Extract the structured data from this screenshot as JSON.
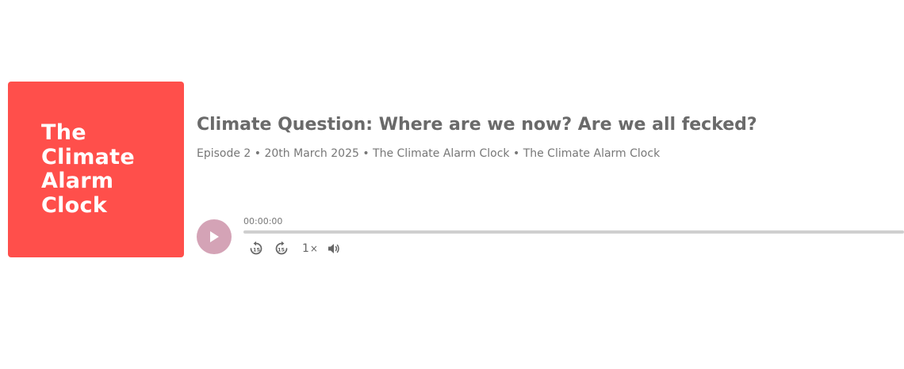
{
  "cover": {
    "lines": [
      "The",
      "Climate",
      "Alarm",
      "Clock"
    ],
    "background": "#ff4f4b"
  },
  "episode": {
    "title": "Climate Question: Where are we now? Are we all fecked?",
    "meta": "Episode 2 • 20th March 2025 • The Climate Alarm Clock • The Climate Alarm Clock"
  },
  "player": {
    "current_time": "00:00:00",
    "progress": 0,
    "speed_value": "1",
    "speed_symbol": "×",
    "rewind_seconds": "15",
    "forward_seconds": "15"
  },
  "icons": {
    "play": "play-icon",
    "rewind": "rewind-15-icon",
    "forward": "forward-15-icon",
    "volume": "volume-icon"
  },
  "colors": {
    "cover": "#ff4f4b",
    "play_button": "#d4a3b6",
    "title": "#6a6a6a",
    "meta": "#777777",
    "track": "#cfcfcf",
    "icon": "#666666"
  }
}
